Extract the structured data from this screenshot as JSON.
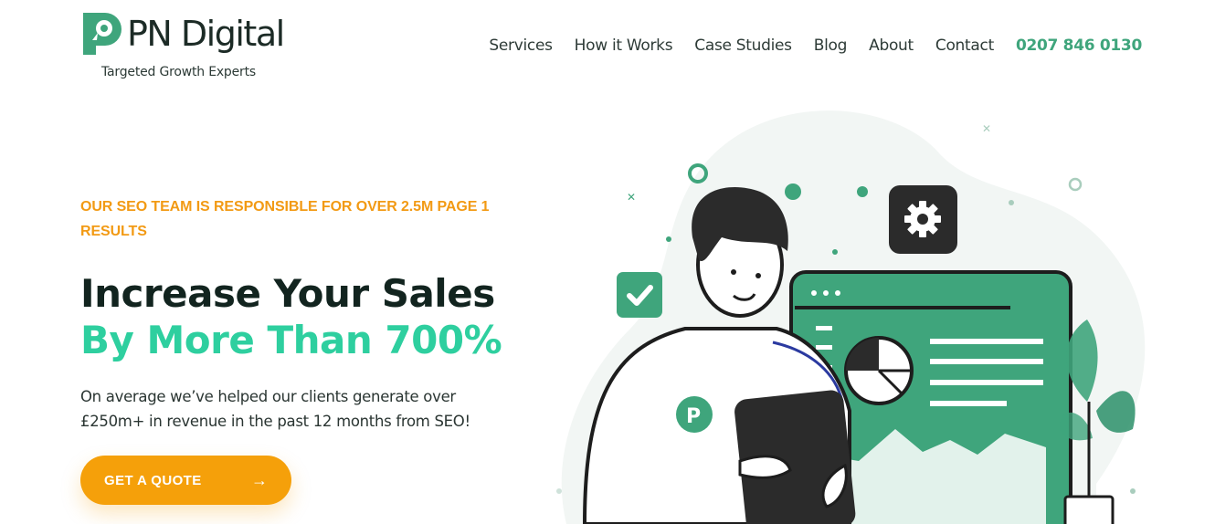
{
  "brand": {
    "name": "PN Digital",
    "tagline": "Targeted Growth Experts",
    "accent": "#3fa57c",
    "highlight": "#2ecf9f",
    "orange": "#f5a00a"
  },
  "nav": {
    "items": [
      "Services",
      "How it Works",
      "Case Studies",
      "Blog",
      "About",
      "Contact"
    ],
    "phone": "0207 846 0130"
  },
  "hero": {
    "kicker": "OUR SEO TEAM IS RESPONSIBLE FOR OVER 2.5M PAGE 1 RESULTS",
    "title_line1": "Increase Your Sales",
    "title_line2": "By More Than 700%",
    "lead": "On average we’ve helped our clients generate over £250m+ in revenue in the past 12 months from SEO!",
    "cta_label": "GET A QUOTE",
    "cta_arrow": "→"
  },
  "illustration": {
    "icons": [
      "gear-icon",
      "checkmark-icon",
      "pie-chart-icon",
      "brand-p-icon",
      "plant-icon"
    ]
  }
}
